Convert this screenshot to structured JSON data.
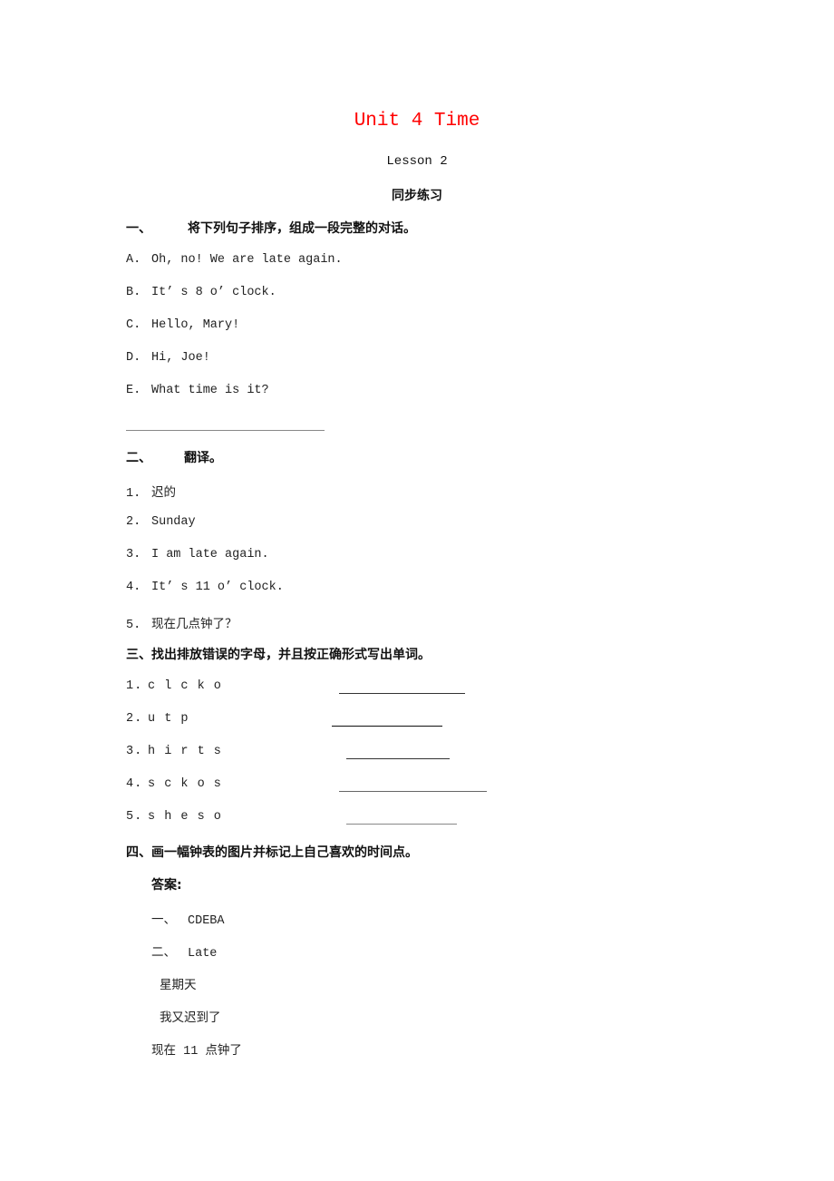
{
  "document": {
    "title": "Unit 4 Time",
    "title_color": "#ff0000",
    "lesson": "Lesson 2",
    "subtitle": "同步练习",
    "section1": {
      "number": "一、",
      "heading": "将下列句子排序，组成一段完整的对话。",
      "items": [
        {
          "label": "A.",
          "text": "Oh, no! We are late again."
        },
        {
          "label": "B.",
          "text": "It’ s 8 o’ clock."
        },
        {
          "label": "C.",
          "text": "Hello, Mary!"
        },
        {
          "label": "D.",
          "text": "Hi, Joe!"
        },
        {
          "label": "E.",
          "text": "What time is it?"
        }
      ]
    },
    "section2": {
      "number": "二、",
      "heading": "翻译。",
      "items": [
        {
          "label": "1.",
          "text": "迟的"
        },
        {
          "label": "2.",
          "text": "Sunday"
        },
        {
          "label": "3.",
          "text": "I am late again."
        },
        {
          "label": "4.",
          "text": "It’ s 11 o’ clock."
        },
        {
          "label": "5.",
          "text": "现在几点钟了？"
        }
      ]
    },
    "section3": {
      "heading": "三、找出排放错误的字母，并且按正确形式写出单词。",
      "items": [
        {
          "label": "1.",
          "text": "c l c k o"
        },
        {
          "label": "2.",
          "text": "u t p"
        },
        {
          "label": "3.",
          "text": "h i r t s"
        },
        {
          "label": "4.",
          "text": "s c k o s"
        },
        {
          "label": "5.",
          "text": "s h e s o"
        }
      ]
    },
    "section4": {
      "heading": "四、画一幅钟表的图片并标记上自己喜欢的时间点。"
    },
    "answers": {
      "heading": "答案:",
      "a1_num": "一、",
      "a1_text": "CDEBA",
      "a2_num": "二、",
      "a2_text": "Late",
      "a2_line2": "星期天",
      "a2_line3": "我又迟到了",
      "a2_line4": "现在 11 点钟了"
    }
  }
}
